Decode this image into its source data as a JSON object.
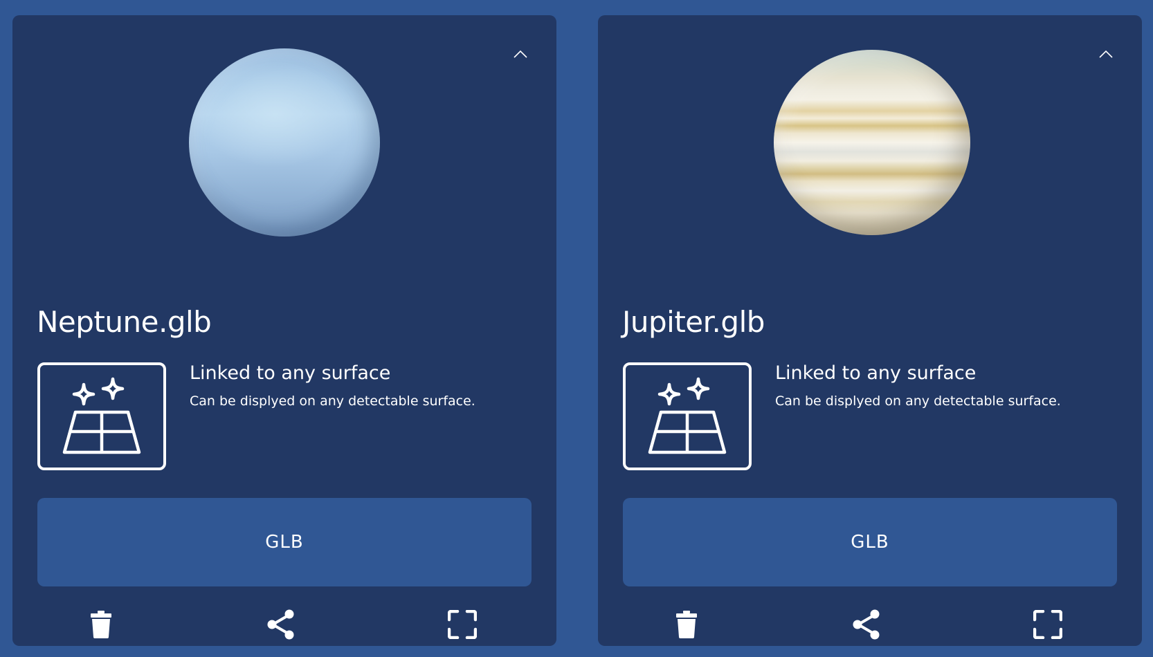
{
  "cards": [
    {
      "file_name": "Neptune.glb",
      "model": "neptune",
      "surface_title": "Linked to any surface",
      "surface_desc": "Can be displyed on any detectable surface.",
      "format_label": "GLB",
      "icons": [
        "chevron-up-icon",
        "surface-sparkle-icon",
        "trash-icon",
        "share-icon",
        "fullscreen-icon"
      ]
    },
    {
      "file_name": "Jupiter.glb",
      "model": "jupiter",
      "surface_title": "Linked to any surface",
      "surface_desc": "Can be displyed on any detectable surface.",
      "format_label": "GLB",
      "icons": [
        "chevron-up-icon",
        "surface-sparkle-icon",
        "trash-icon",
        "share-icon",
        "fullscreen-icon"
      ]
    }
  ],
  "colors": {
    "page_background": "#305794",
    "card_background": "#223864",
    "button_background": "#305794",
    "text": "#ffffff"
  }
}
